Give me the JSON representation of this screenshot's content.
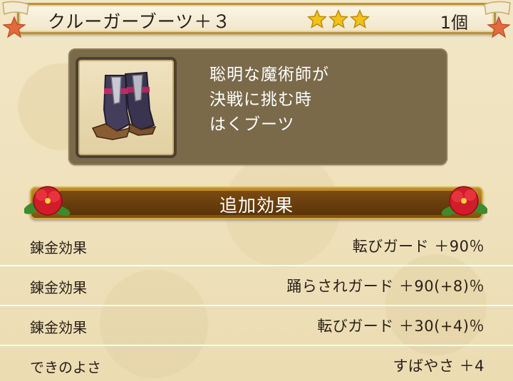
{
  "item": {
    "name": "クルーガーブーツ＋３",
    "stars": 3,
    "count": "1個",
    "description": "聡明な魔術師が\n決戦に挑む時\nはくブーツ",
    "icon": "boots-icon"
  },
  "section": {
    "title": "追加効果"
  },
  "effects": [
    {
      "label": "錬金効果",
      "value": "転びガード ＋90％"
    },
    {
      "label": "錬金効果",
      "value": "踊らされガード ＋90(+8)％"
    },
    {
      "label": "錬金効果",
      "value": "転びガード ＋30(+4)％"
    },
    {
      "label": "できのよさ",
      "value": "すばやさ ＋4"
    }
  ],
  "colors": {
    "star": "#f2c21a",
    "header": "#a26f1a",
    "panel": "#7a6a4a"
  }
}
